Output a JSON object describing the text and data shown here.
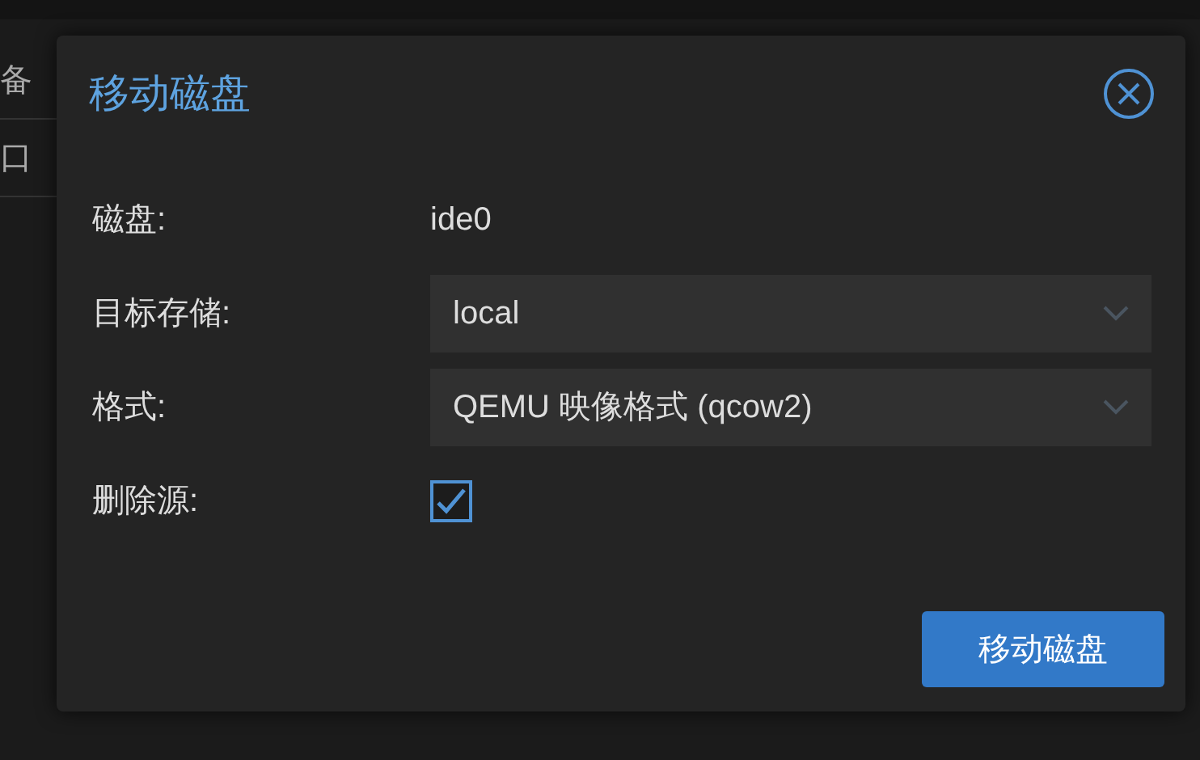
{
  "background": {
    "rows": [
      {
        "label": "备"
      },
      {
        "label": "口"
      }
    ]
  },
  "dialog": {
    "title": "移动磁盘",
    "fields": [
      {
        "kind": "text",
        "label": "磁盘:",
        "value": "ide0"
      },
      {
        "kind": "select",
        "label": "目标存储:",
        "value": "local"
      },
      {
        "kind": "select",
        "label": "格式:",
        "value": "QEMU 映像格式 (qcow2)"
      },
      {
        "kind": "checkbox",
        "label": "删除源:",
        "checked": true
      }
    ],
    "button": "移动磁盘"
  }
}
